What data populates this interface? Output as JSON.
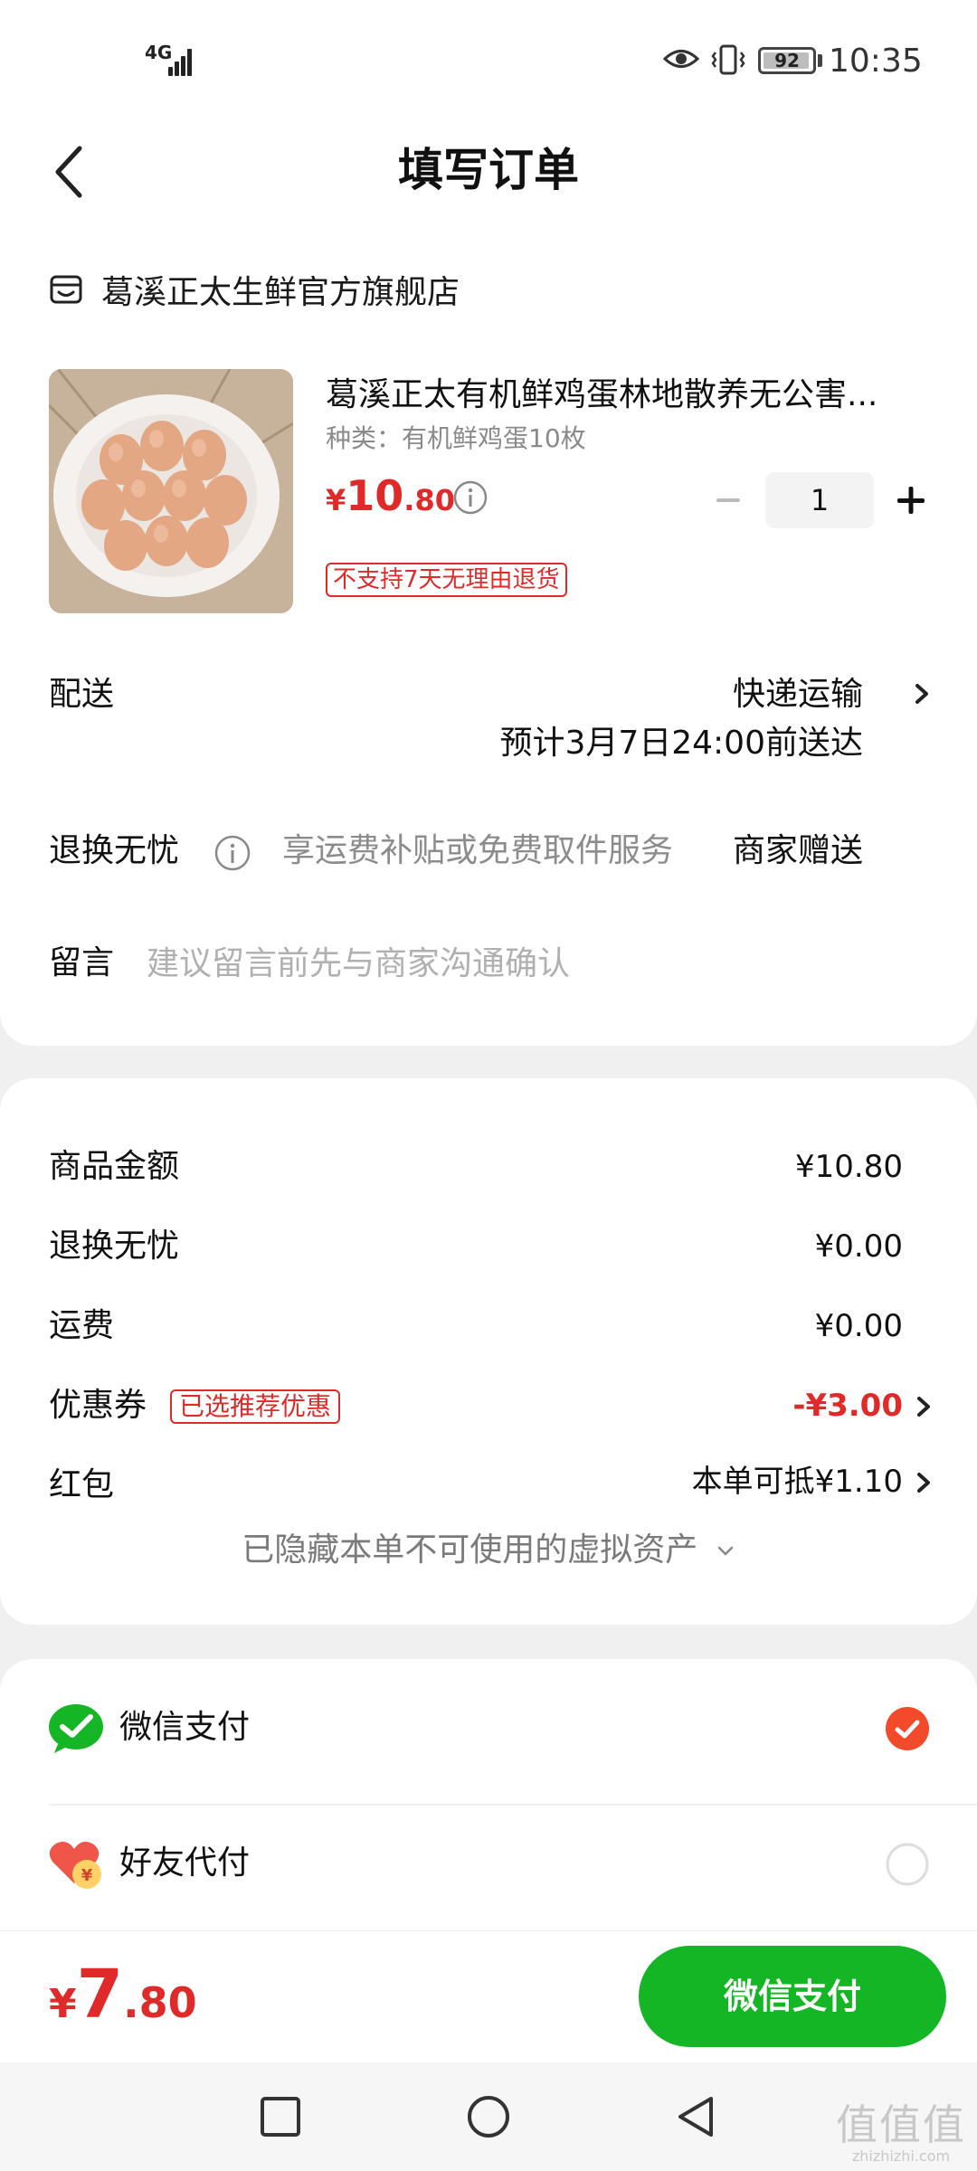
{
  "status_bar": {
    "network": "4G",
    "battery": "92",
    "time": "10:35"
  },
  "header": {
    "title": "填写订单"
  },
  "shop": {
    "name": "葛溪正太生鲜官方旗舰店"
  },
  "product": {
    "title": "葛溪正太有机鲜鸡蛋林地散养无公害...",
    "spec": "种类：有机鲜鸡蛋10枚",
    "price_currency": "¥",
    "price_integer": "10",
    "price_decimal": ".80",
    "quantity": "1",
    "return_policy": "不支持7天无理由退货"
  },
  "delivery": {
    "label": "配送",
    "method": "快递运输",
    "eta": "预计3月7日24:00前送达"
  },
  "worry_free": {
    "label": "退换无忧",
    "description": "享运费补贴或免费取件服务",
    "gift": "商家赠送"
  },
  "note": {
    "label": "留言",
    "placeholder": "建议留言前先与商家沟通确认"
  },
  "costs": {
    "goods_label": "商品金额",
    "goods_value": "¥10.80",
    "worry_label": "退换无忧",
    "worry_value": "¥0.00",
    "shipping_label": "运费",
    "shipping_value": "¥0.00",
    "coupon_label": "优惠券",
    "coupon_tag": "已选推荐优惠",
    "coupon_value": "-¥3.00",
    "redpacket_label": "红包",
    "redpacket_value": "本单可抵¥1.10",
    "hidden_assets": "已隐藏本单不可使用的虚拟资产"
  },
  "payment": {
    "options": [
      {
        "label": "微信支付",
        "selected": true
      },
      {
        "label": "好友代付",
        "selected": false
      }
    ]
  },
  "bottom": {
    "total_currency": "¥",
    "total_integer": "7",
    "total_decimal": ".80",
    "pay_button": "微信支付"
  },
  "watermark": {
    "big": "值值值",
    "small": "zhizhizhi.com"
  },
  "colors": {
    "price_red": "#e02a2a",
    "wechat_green": "#15b626",
    "check_orange": "#f24a2a"
  }
}
